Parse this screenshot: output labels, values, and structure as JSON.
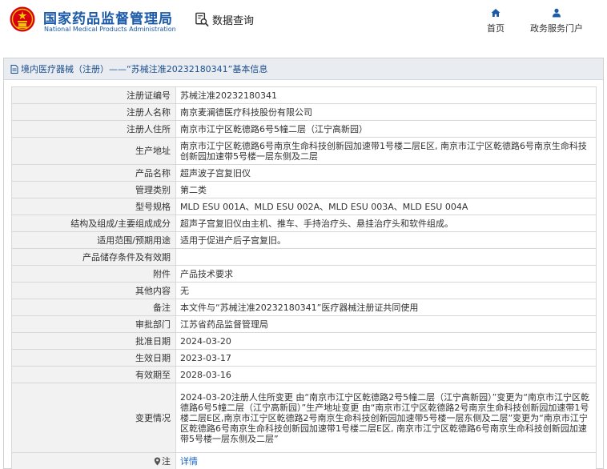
{
  "site": {
    "name_cn": "国家药品监督管理局",
    "name_en": "National Medical Products Administration",
    "search_label": "数据查询"
  },
  "nav": {
    "home": "首页",
    "portal": "政务服务门户"
  },
  "breadcrumb": "境内医疗器械（注册）——“苏械注准20232180341”基本信息",
  "rows": [
    {
      "key": "注册证编号",
      "value": "苏械注准20232180341"
    },
    {
      "key": "注册人名称",
      "value": "南京麦澜德医疗科技股份有限公司"
    },
    {
      "key": "注册人住所",
      "value": "南京市江宁区乾德路6号5幢二层（江宁高新园）"
    },
    {
      "key": "生产地址",
      "value": "南京市江宁区乾德路6号南京生命科技创新园加速带1号楼二层E区, 南京市江宁区乾德路6号南京生命科技创新园加速带5号楼一层东侧及二层"
    },
    {
      "key": "产品名称",
      "value": "超声波子宫复旧仪"
    },
    {
      "key": "管理类别",
      "value": "第二类"
    },
    {
      "key": "型号规格",
      "value": "MLD ESU 001A、MLD ESU 002A、MLD ESU 003A、MLD ESU 004A"
    },
    {
      "key": "结构及组成/主要组成成分",
      "value": "超声子宫复旧仪由主机、推车、手持治疗头、悬挂治疗头和软件组成。"
    },
    {
      "key": "适用范围/预期用途",
      "value": "适用于促进产后子宫复旧。"
    },
    {
      "key": "产品储存条件及有效期",
      "value": ""
    },
    {
      "key": "附件",
      "value": "产品技术要求"
    },
    {
      "key": "其他内容",
      "value": "无"
    },
    {
      "key": "备注",
      "value": "本文件与“苏械注准20232180341”医疗器械注册证共同使用"
    },
    {
      "key": "审批部门",
      "value": "江苏省药品监督管理局"
    },
    {
      "key": "批准日期",
      "value": "2024-03-20"
    },
    {
      "key": "生效日期",
      "value": "2023-03-17"
    },
    {
      "key": "有效期至",
      "value": "2028-03-16"
    },
    {
      "key": "变更情况",
      "value": "2024-03-20注册人住所变更 由“南京市江宁区乾德路2号5幢二层（江宁高新园）”变更为“南京市江宁区乾德路6号5幢二层（江宁高新园）”生产地址变更 由“南京市江宁区乾德路2号南京生命科技创新园加速带1号楼二层E区,南京市江宁区乾德路2号南京生命科技创新园加速带5号楼一层东侧及二层”变更为“南京市江宁区乾德路6号南京生命科技创新园加速带1号楼二层E区, 南京市江宁区乾德路6号南京生命科技创新园加速带5号楼一层东侧及二层”"
    }
  ],
  "note_row": {
    "key": "注",
    "link": "详情"
  },
  "colors": {
    "brand_blue": "#1a5aa8",
    "emblem_red": "#d7000f",
    "link_blue": "#1a64c8"
  }
}
